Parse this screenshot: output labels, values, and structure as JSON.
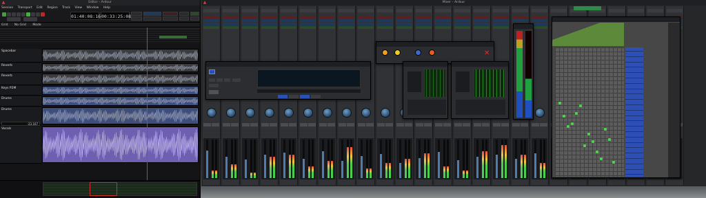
{
  "editor": {
    "window_title": "Editor – Ardour",
    "menu": [
      "Session",
      "Transport",
      "Edit",
      "Region",
      "Track",
      "View",
      "Window",
      "Help"
    ],
    "primary_clock": "01:40:08:16",
    "secondary_clock": "00:33:25:08",
    "tools_row": [
      "Grid",
      "No Grid",
      "Mode"
    ],
    "tracks": [
      {
        "name": "Spacebar",
        "color": "#8a8a8a"
      },
      {
        "name": "Reverb",
        "color": "#5a8fb5"
      },
      {
        "name": "Reverb",
        "color": "#5a8fb5"
      },
      {
        "name": "Keys P2M",
        "color": "#6a7dbf"
      },
      {
        "name": "Drums",
        "color": "#6a7dbf"
      },
      {
        "name": "Drums",
        "color": "#6a7dbf"
      },
      {
        "name": "Vocals",
        "color": "#7b68ba"
      }
    ],
    "gain_readout": "-23.167",
    "playhead_color": "#e03030"
  },
  "mixer": {
    "window_title": "Mixer – Ardour",
    "strip_count": 25,
    "fader_levels": [
      0.72,
      0.55,
      0.48,
      0.6,
      0.66,
      0.5,
      0.7,
      0.45,
      0.58,
      0.62,
      0.4,
      0.52,
      0.68,
      0.47,
      0.55,
      0.61,
      0.5,
      0.64,
      0.57,
      0.49,
      0.7,
      0.53,
      0.59,
      0.46,
      0.63
    ],
    "meter_levels": [
      0.2,
      0.35,
      0.15,
      0.55,
      0.6,
      0.3,
      0.45,
      0.8,
      0.25,
      0.4,
      0.5,
      0.65,
      0.3,
      0.2,
      0.7,
      0.85,
      0.6,
      0.4,
      0.35,
      0.5,
      0.3,
      0.45,
      0.55,
      0.25,
      0.2
    ]
  },
  "plugin_windows": [
    {
      "id": "ewa",
      "title": ""
    },
    {
      "id": "knob",
      "title": ""
    },
    {
      "id": "meter1",
      "title": ""
    },
    {
      "id": "meter2",
      "title": ""
    },
    {
      "id": "vmeter",
      "title": ""
    },
    {
      "id": "matrix",
      "title": ""
    }
  ],
  "matrix": {
    "row_labels": [
      "",
      "",
      "",
      "",
      "",
      "",
      "",
      "",
      "",
      "",
      "",
      "",
      "",
      "",
      "",
      "",
      "",
      "",
      "",
      "",
      "",
      "",
      "",
      ""
    ],
    "connections_fraction": [
      [
        0.05,
        0.42
      ],
      [
        0.11,
        0.52
      ],
      [
        0.17,
        0.6
      ],
      [
        0.23,
        0.58
      ],
      [
        0.35,
        0.44
      ],
      [
        0.47,
        0.66
      ],
      [
        0.53,
        0.72
      ],
      [
        0.59,
        0.8
      ],
      [
        0.65,
        0.85
      ],
      [
        0.71,
        0.62
      ],
      [
        0.77,
        0.7
      ],
      [
        0.41,
        0.75
      ],
      [
        0.29,
        0.5
      ],
      [
        0.83,
        0.88
      ]
    ]
  },
  "colors": {
    "accent": "#2f8a4a",
    "matrix_header": "#5c8a3a",
    "matrix_row": "#2d4fb6",
    "meter_green": "#4ad04e"
  }
}
